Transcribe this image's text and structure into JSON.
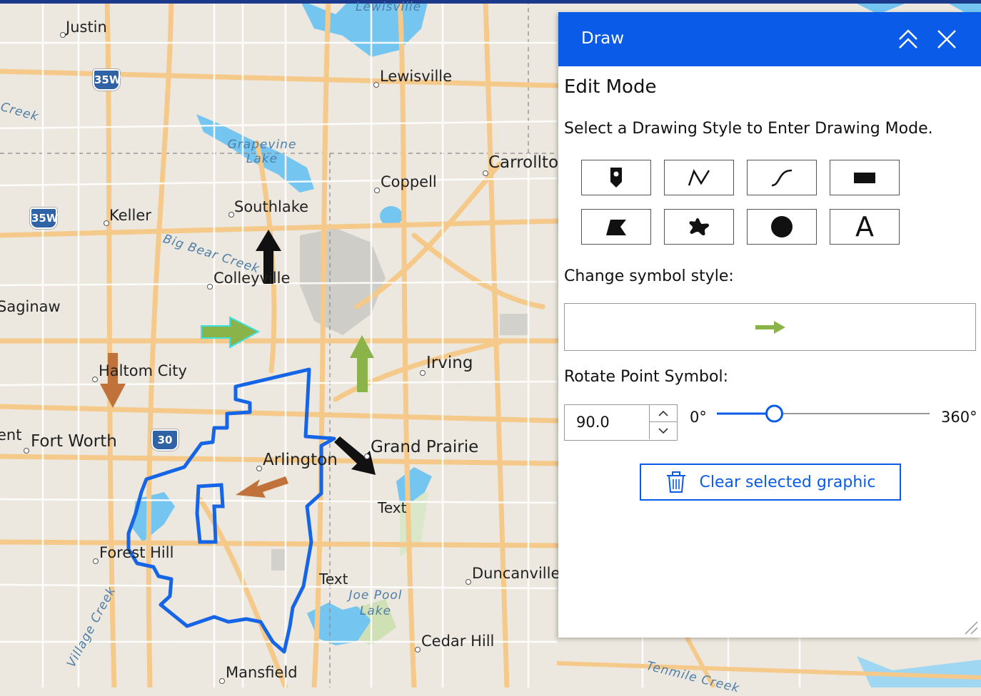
{
  "map": {
    "places": [
      {
        "id": "justin",
        "label": "Justin"
      },
      {
        "id": "lewisville",
        "label": "Lewisville"
      },
      {
        "id": "carrollton",
        "label": "Carrollto"
      },
      {
        "id": "coppell",
        "label": "Coppell"
      },
      {
        "id": "southlake",
        "label": "Southlake"
      },
      {
        "id": "keller",
        "label": "Keller"
      },
      {
        "id": "colleyville",
        "label": "Colleyville"
      },
      {
        "id": "saginaw",
        "label": "Saginaw"
      },
      {
        "id": "haltom",
        "label": "Haltom City"
      },
      {
        "id": "irving",
        "label": "Irving"
      },
      {
        "id": "fortworth",
        "label": "Fort Worth"
      },
      {
        "id": "arlington",
        "label": "Arlington"
      },
      {
        "id": "grandprairie",
        "label": "Grand Prairie"
      },
      {
        "id": "foresthill",
        "label": "Forest Hill"
      },
      {
        "id": "duncanville",
        "label": "Duncanville"
      },
      {
        "id": "cedarhill",
        "label": "Cedar Hill"
      },
      {
        "id": "mansfield",
        "label": "Mansfield"
      },
      {
        "id": "ent",
        "label": "ent"
      }
    ],
    "water": [
      {
        "id": "lewisville-lake",
        "label": "Lewisville"
      },
      {
        "id": "grapevine-lake",
        "label": "Grapevine Lake"
      },
      {
        "id": "big-bear",
        "label": "Big Bear Creek"
      },
      {
        "id": "joe-pool",
        "label": "Joe Pool Lake"
      },
      {
        "id": "village-creek",
        "label": "Village Creek"
      },
      {
        "id": "tenmile",
        "label": "Tenmile Creek"
      },
      {
        "id": "creek-left",
        "label": "Creek"
      }
    ],
    "shields": [
      {
        "id": "i35w-north",
        "label": "35W"
      },
      {
        "id": "i35w-keller",
        "label": "35W"
      },
      {
        "id": "i30",
        "label": "30"
      }
    ],
    "text_graphics": [
      {
        "id": "text-1",
        "label": "Text"
      },
      {
        "id": "text-2",
        "label": "Text"
      }
    ]
  },
  "panel": {
    "title": "Draw",
    "edit_mode": "Edit Mode",
    "instruction": "Select a Drawing Style to Enter Drawing Mode.",
    "tools": [
      {
        "id": "point",
        "icon": "map-pin-icon"
      },
      {
        "id": "polyline",
        "icon": "polyline-icon"
      },
      {
        "id": "freehand-polyline",
        "icon": "freehand-line-icon"
      },
      {
        "id": "rectangle",
        "icon": "rectangle-icon"
      },
      {
        "id": "polygon",
        "icon": "polygon-icon"
      },
      {
        "id": "freehand-polygon",
        "icon": "freehand-polygon-icon"
      },
      {
        "id": "circle",
        "icon": "circle-icon"
      },
      {
        "id": "text",
        "icon": "text-icon",
        "label": "A"
      }
    ],
    "symbol_label": "Change symbol style:",
    "symbol_preview_color": "#8ab44a",
    "rotate_label": "Rotate Point Symbol:",
    "rotation_value": "90.0",
    "rotation_min": "0°",
    "rotation_max": "360°",
    "rotation_fraction": 0.25,
    "clear_button": "Clear selected graphic"
  },
  "colors": {
    "header_blue": "#0a5be8",
    "polygon_blue": "#1565e6",
    "arrow_black": "#111111",
    "arrow_green": "#8ab44a",
    "arrow_brown": "#c0723a",
    "road": "#f5c98a",
    "water": "#74c6f1"
  }
}
